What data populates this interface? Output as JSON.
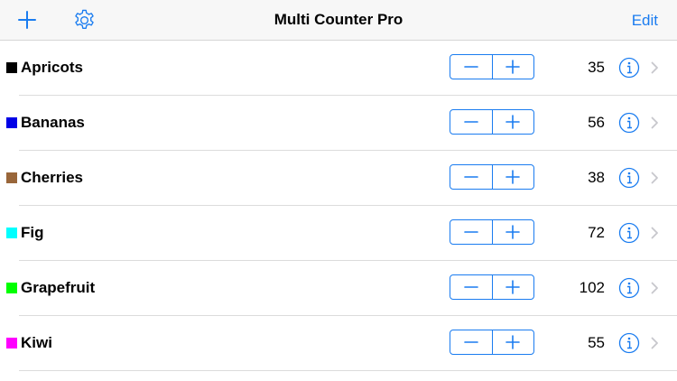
{
  "navbar": {
    "title": "Multi Counter Pro",
    "edit_label": "Edit",
    "add_icon": "plus-icon",
    "settings_icon": "gear-icon"
  },
  "accent_color": "#1a7cf0",
  "counters": [
    {
      "name": "Apricots",
      "count": "35",
      "color": "#000000"
    },
    {
      "name": "Bananas",
      "count": "56",
      "color": "#0000e6"
    },
    {
      "name": "Cherries",
      "count": "38",
      "color": "#99663a"
    },
    {
      "name": "Fig",
      "count": "72",
      "color": "#00ffff"
    },
    {
      "name": "Grapefruit",
      "count": "102",
      "color": "#00ff00"
    },
    {
      "name": "Kiwi",
      "count": "55",
      "color": "#ff00ff"
    }
  ]
}
